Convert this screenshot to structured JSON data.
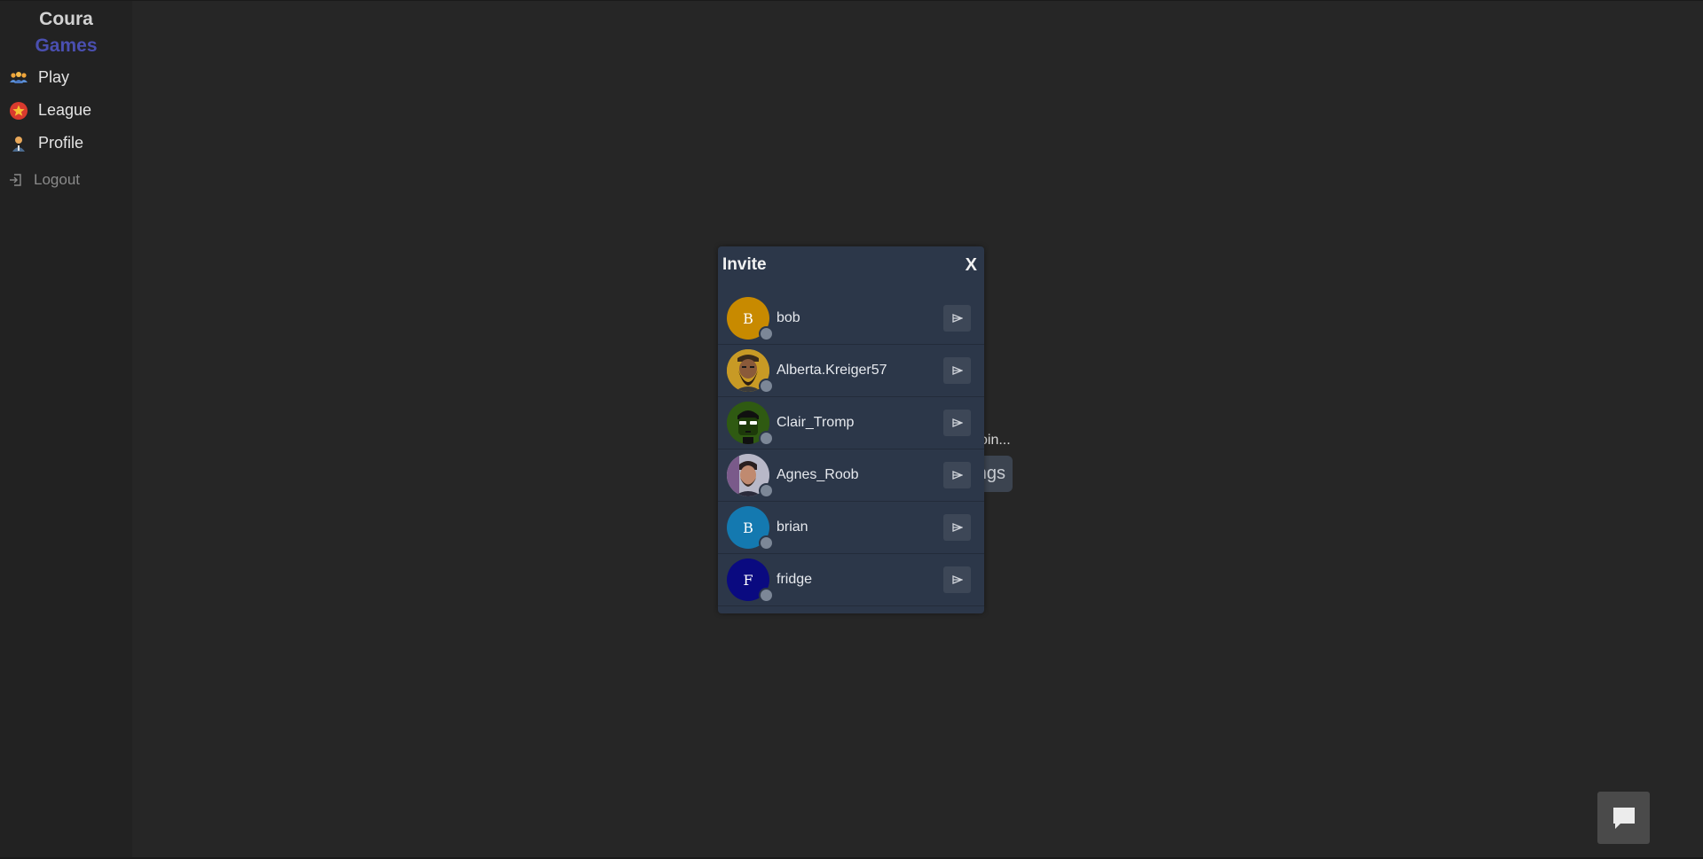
{
  "brand": {
    "line1": "Coura",
    "line2": "Games"
  },
  "sidebar": {
    "items": [
      {
        "label": "Play",
        "icon": "people-group-icon"
      },
      {
        "label": "League",
        "icon": "star-badge-icon"
      },
      {
        "label": "Profile",
        "icon": "user-icon"
      }
    ],
    "logout": {
      "label": "Logout",
      "icon": "logout-icon"
    }
  },
  "background": {
    "partial_text": "oin...",
    "partial_button": "ngs"
  },
  "invite_modal": {
    "title": "Invite",
    "close_label": "X",
    "users": [
      {
        "name": "bob",
        "initial": "B",
        "avatar_color": "#c88a00",
        "avatar_type": "initial",
        "status": "offline"
      },
      {
        "name": "Alberta.Kreiger57",
        "initial": "",
        "avatar_color": "#c89a25",
        "avatar_type": "photo-bearded-man",
        "status": "offline"
      },
      {
        "name": "Clair_Tromp",
        "initial": "",
        "avatar_color": "#2f5a12",
        "avatar_type": "illustration-sunglasses",
        "status": "offline"
      },
      {
        "name": "Agnes_Roob",
        "initial": "",
        "avatar_color": "#6b6f86",
        "avatar_type": "photo-man",
        "status": "offline"
      },
      {
        "name": "brian",
        "initial": "B",
        "avatar_color": "#1479b0",
        "avatar_type": "initial",
        "status": "offline"
      },
      {
        "name": "fridge",
        "initial": "F",
        "avatar_color": "#0a0a80",
        "avatar_type": "initial",
        "status": "offline"
      }
    ],
    "send_icon": "send-arrow-icon"
  },
  "chat_button": {
    "icon": "chat-bubble-icon"
  }
}
